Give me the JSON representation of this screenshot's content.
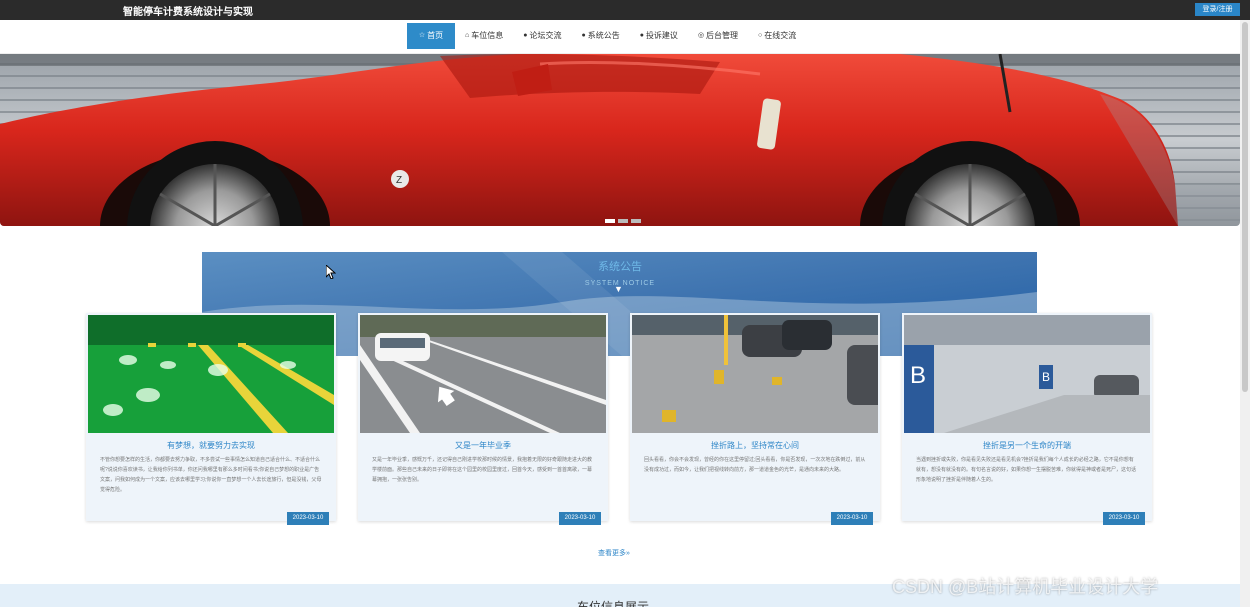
{
  "header": {
    "site_title": "智能停车计费系统设计与实现",
    "login_label": "登录/注册"
  },
  "nav": {
    "items": [
      {
        "label": "首页",
        "icon": "star-icon",
        "active": true
      },
      {
        "label": "车位信息",
        "icon": "home-icon"
      },
      {
        "label": "论坛交流",
        "icon": "info-icon"
      },
      {
        "label": "系统公告",
        "icon": "help-icon"
      },
      {
        "label": "投诉建议",
        "icon": "info-icon"
      },
      {
        "label": "后台管理",
        "icon": "settings-icon"
      },
      {
        "label": "在线交流",
        "icon": "chat-icon"
      }
    ]
  },
  "banner": {
    "slides": 3,
    "active_slide": 1
  },
  "notice_section": {
    "title": "系统公告",
    "subtitle": "SYSTEM NOTICE",
    "cards": [
      {
        "title": "有梦想，就要努力去实现",
        "text": "不管你想要怎样的生活，你都要去努力争取，不多尝试一些事情怎么知道自己适合什么、不适合什么呢?说说你喜欢读书，让我给你列书单，你还问我哪里有那么多时间看书;你说自己梦想的职业是广告文案，问我如何成为一个文案，应该去哪里学习;你说你一直梦想一个人去长途旅行，但是没钱，父母觉得危险。",
        "date": "2023-03-10",
        "image": "parking-garage-green"
      },
      {
        "title": "又是一年毕业季",
        "text": "又是一年毕业季，感慨万千，还记得自己刚进学校那时候的情景，我抱着无限的好奇跟随走进大的教学楼前面。那些自己未来的日子即将在这个园里的校园里度过，回首今天，感受到一首首离歌，一幕幕拥抱，一张张告别。",
        "date": "2023-03-10",
        "image": "street-parking"
      },
      {
        "title": "挫折路上，坚持常在心间",
        "text": "回头看看，你会不会发现，曾经的你在这里停留过;回头看看，你是否发现，一次次地在跌倒过，前从没有成功过，而如今，让我们把视线转向前方，那一道道金色的光芒，是通向未来的大路。",
        "date": "2023-03-10",
        "image": "parking-lot-locks"
      },
      {
        "title": "挫折是另一个生命的开端",
        "text": "当遇到挫折或失败，你是看见失败还是看见机会?挫折是我们每个人成长的必经之路，它不是你想有就有，想没有就没有的。有句名言说的好，如果你想一生摆脱苦难，你就得是神或者是死尸，这句话形象地说明了挫折是伴随着人生的。",
        "date": "2023-03-10",
        "image": "underground-garage"
      }
    ],
    "more_label": "查看更多"
  },
  "bottom_section": {
    "title": "车位信息展示"
  },
  "watermark": "CSDN @B站计算机毕业设计大学",
  "colors": {
    "accent": "#2e8bc9",
    "topbar": "#2b2b2b"
  }
}
